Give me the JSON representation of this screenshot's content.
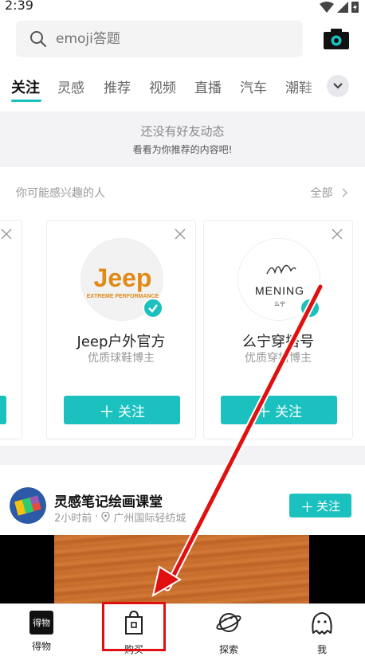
{
  "status_bar": {
    "time": "2:39"
  },
  "search": {
    "placeholder": "emoji答题"
  },
  "tabs": [
    {
      "label": "关注",
      "active": true
    },
    {
      "label": "灵感"
    },
    {
      "label": "推荐"
    },
    {
      "label": "视频"
    },
    {
      "label": "直播"
    },
    {
      "label": "汽车"
    },
    {
      "label": "潮鞋"
    }
  ],
  "empty_banner": {
    "line1": "还没有好友动态",
    "line2": "看看为你推荐的内容吧!"
  },
  "recommend": {
    "title": "你可能感兴趣的人",
    "all_label": "全部",
    "cards": [
      {
        "name": "Jeep户外官方",
        "desc": "优质球鞋博主",
        "follow": "关注",
        "logo_text": "Jeep",
        "logo_sub": "EXTREME PERFORMANCE"
      },
      {
        "name": "么宁穿搭号",
        "desc": "优质穿搭博主",
        "follow": "关注",
        "logo_text": "MENING",
        "logo_sub": "么宁"
      }
    ]
  },
  "post": {
    "author": "灵感笔记绘画课堂",
    "time": "2小时前",
    "separator": "·",
    "location": "广州国际轻纺城",
    "follow": "关注"
  },
  "bottom_nav": [
    {
      "label": "得物",
      "icon_text": "得物"
    },
    {
      "label": "购买"
    },
    {
      "label": "探索"
    },
    {
      "label": "我"
    }
  ],
  "colors": {
    "accent": "#1bc1bf",
    "annotation": "#e01010"
  }
}
